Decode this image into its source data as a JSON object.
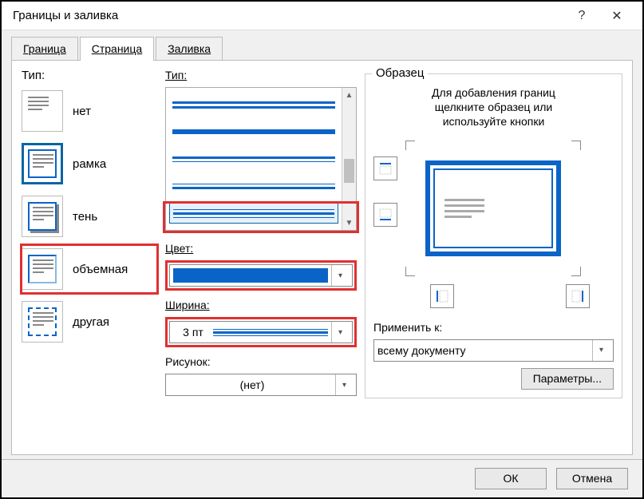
{
  "window": {
    "title": "Границы и заливка"
  },
  "tabs": {
    "border": "Граница",
    "page": "Страница",
    "shading": "Заливка"
  },
  "type_section": {
    "label": "Тип:",
    "options": {
      "none": "нет",
      "box": "рамка",
      "shadow": "тень",
      "threeD": "объемная",
      "custom": "другая"
    }
  },
  "style_section": {
    "style_label": "Тип:",
    "color_label": "Цвет:",
    "width_label": "Ширина:",
    "width_value": "3 пт",
    "art_label": "Рисунок:",
    "art_value": "(нет)"
  },
  "preview": {
    "legend": "Образец",
    "hint_line1": "Для добавления границ",
    "hint_line2": "щелкните образец или",
    "hint_line3": "используйте кнопки",
    "apply_label": "Применить к:",
    "apply_value": "всему документу",
    "params_btn": "Параметры..."
  },
  "footer": {
    "ok": "ОК",
    "cancel": "Отмена"
  }
}
